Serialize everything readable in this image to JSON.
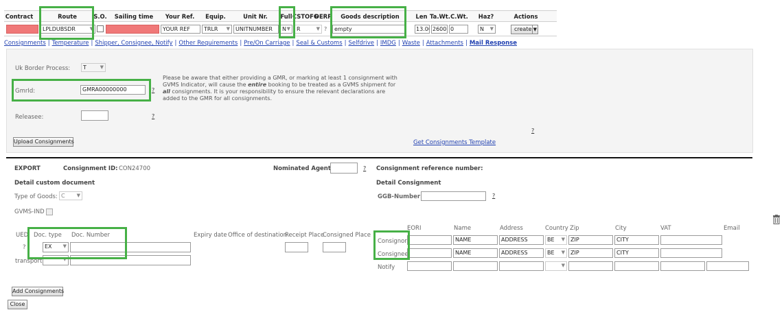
{
  "header": {
    "columns": [
      "Contract",
      "Route",
      "S.O.",
      "Sailing time",
      "Your Ref.",
      "Equip.",
      "Unit Nr.",
      "Full",
      "CSTOFG",
      "DERP",
      "Goods description",
      "Len",
      "Ta.Wt.",
      "C.Wt.",
      "Haz?",
      "Actions"
    ]
  },
  "row": {
    "route": "LPLDUBSDR",
    "your_ref": "YOUR REF",
    "equip": "TRLR",
    "unit_nr": "UNITNUMBER",
    "full": "N",
    "cstofg": "R",
    "derp": "?",
    "goods": "empty",
    "len": "13.00",
    "tawt": "2600",
    "cwt": "0",
    "haz": "N",
    "action": "create"
  },
  "tabs": [
    "Consignments",
    "Temperature",
    "Shipper, Consignee, Notify",
    "Other Requirements",
    "Pre/On Carriage",
    "Seal & Customs",
    "Selfdrive",
    "IMDG",
    "Waste",
    "Attachments",
    "Mail Response"
  ],
  "form": {
    "uk_border_label": "Uk Border Process:",
    "uk_border_value": "T",
    "gmr_label": "GmrId:",
    "gmr_value": "GMRA00000000",
    "releasee_label": "Releasee:",
    "help": "?",
    "notice_1": "Please be aware that either providing a GMR, or marking at least 1 consignment with GVMS Indicator, will cause the ",
    "notice_entire": "entire",
    "notice_2": " booking to be treated as a GVMS shipment for ",
    "notice_all": "all",
    "notice_3": " consignments. It is your responsibility to ensure the relevant declarations are added to the GMR for all consignments.",
    "upload_button": "Upload Consignments",
    "template_link": "Get Consignments Template"
  },
  "consignment": {
    "export": "EXPORT",
    "id_label": "Consignment ID:",
    "id_value": "CON24700",
    "agent_label": "Nominated Agent :",
    "ref_label": "Consignment reference number:",
    "detail_custom": "Detail custom document",
    "detail_consignment": "Detail Consignment",
    "type_label": "Type of Goods:",
    "type_value": "C",
    "ggb_label": "GGB-Number:",
    "gvms_label": "GVMS-IND",
    "ued": "UED",
    "ued_q": "?",
    "doc_type_label": "Doc. type",
    "doc_number_label": "Doc. Number",
    "doc_type_value": "EX",
    "expiry": "Expiry date",
    "office": "Office of destination",
    "receipt": "Receipt Place",
    "consigned": "Consigned Place",
    "transport": "transport",
    "party_cols": [
      "EORI",
      "Name",
      "Address",
      "Country",
      "Zip",
      "City",
      "VAT",
      "Email"
    ],
    "parties": [
      {
        "role": "Consignor",
        "name": "NAME",
        "address": "ADDRESS",
        "country": "BE",
        "zip": "ZIP",
        "city": "CITY"
      },
      {
        "role": "Consignee",
        "name": "NAME",
        "address": "ADDRESS",
        "country": "BE",
        "zip": "ZIP",
        "city": "CITY"
      },
      {
        "role": "Notify",
        "name": "",
        "address": "",
        "country": "",
        "zip": "",
        "city": ""
      }
    ],
    "add_button": "Add Consignments",
    "close_button": "Close"
  }
}
